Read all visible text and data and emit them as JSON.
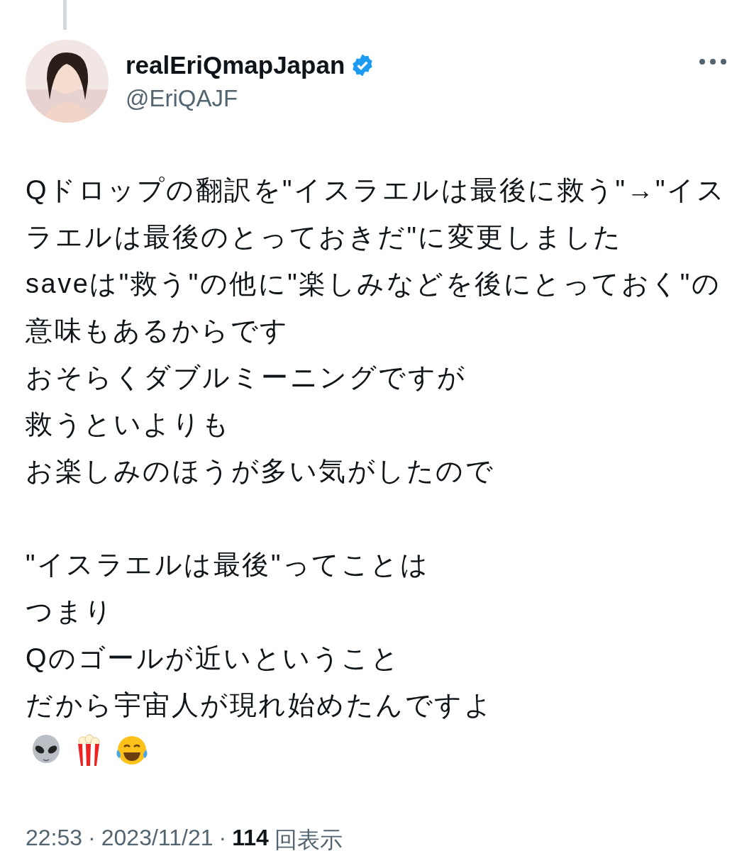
{
  "tweet": {
    "author": {
      "name": "realEriQmapJapan",
      "verified": true,
      "handle": "@EriQAJF"
    },
    "paragraphs": [
      [
        "Qドロップの翻訳を\"イスラエルは最後に救う\"→\"イスラエルは最後のとっておきだ\"に変更しました",
        "saveは\"救う\"の他に\"楽しみなどを後にとっておく\"の意味もあるからです",
        "おそらくダブルミーニングですが",
        "救うといよりも",
        "お楽しみのほうが多い気がしたので"
      ],
      [
        "\"イスラエルは最後\"ってことは",
        "つまり",
        "Qのゴールが近いということ",
        "だから宇宙人が現れ始めたんですよ"
      ]
    ],
    "emojis": [
      {
        "kind": "alien"
      },
      {
        "kind": "popcorn"
      },
      {
        "kind": "laughing"
      }
    ],
    "footer": {
      "time": "22:53",
      "sep1": "·",
      "date": "2023/11/21",
      "sep2": "·",
      "views": "114",
      "views_label": "回表示"
    }
  }
}
